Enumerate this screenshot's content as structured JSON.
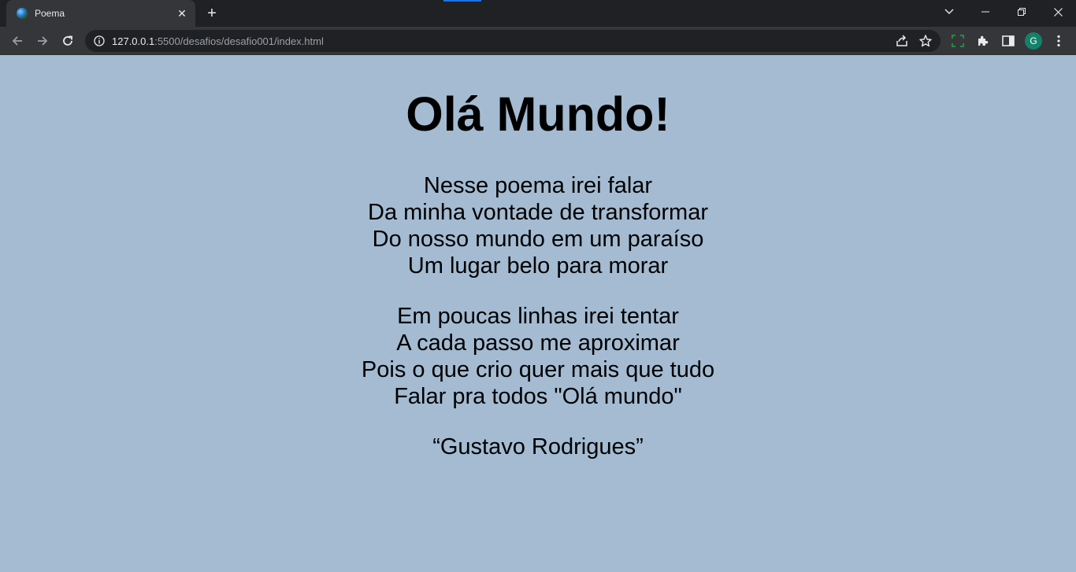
{
  "browser": {
    "tab": {
      "title": "Poema",
      "close_glyph": "✕"
    },
    "new_tab_glyph": "+",
    "address": {
      "host": "127.0.0.1",
      "path": ":5500/desafios/desafio001/index.html"
    },
    "profile_initial": "G",
    "colors": {
      "tab_bar": "#202124",
      "toolbar": "#35363a",
      "avatar": "#13826b",
      "accent": "#1a73e8"
    }
  },
  "page": {
    "background": "#a4bbd2",
    "heading": "Olá Mundo!",
    "stanzas": [
      [
        "Nesse poema irei falar",
        "Da minha vontade de transformar",
        "Do nosso mundo em um paraíso",
        "Um lugar belo para morar"
      ],
      [
        "Em poucas linhas irei tentar",
        "A cada passo me aproximar",
        "Pois o que crio quer mais que tudo",
        "Falar pra todos \"Olá mundo\""
      ]
    ],
    "signature": "“Gustavo Rodrigues”"
  }
}
